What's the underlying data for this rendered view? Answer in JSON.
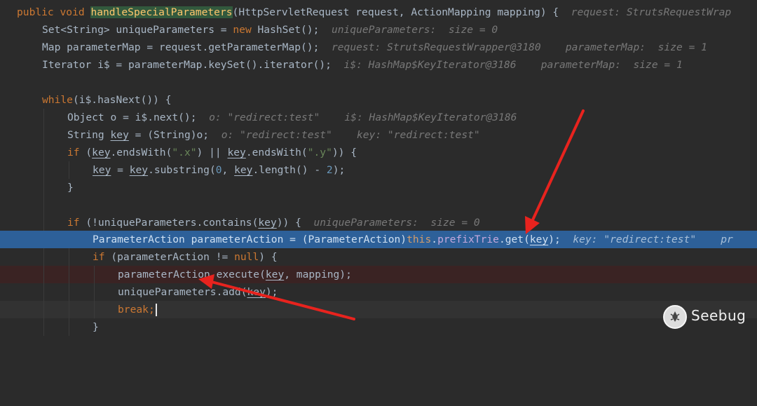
{
  "code": {
    "l1": {
      "kw": "public void ",
      "method": "handleSpecialParameters",
      "rest": "(HttpServletRequest request, ActionMapping mapping) {",
      "hint": "request: StrutsRequestWrap"
    },
    "l2": {
      "a": "Set<String> uniqueParameters = ",
      "kw": "new",
      "b": " HashSet();",
      "hint": "uniqueParameters:  size = 0"
    },
    "l3": {
      "a": "Map parameterMap = request.getParameterMap();",
      "hint": "request: StrutsRequestWrapper@3180    parameterMap:  size = 1"
    },
    "l4": {
      "a": "Iterator i$ = parameterMap.keySet().iterator();",
      "hint": "i$: HashMap$KeyIterator@3186    parameterMap:  size = 1"
    },
    "l6": {
      "kw": "while",
      "a": "(i$.hasNext()) {"
    },
    "l7": {
      "a": "Object o = i$.next();",
      "hint": "o: \"redirect:test\"    i$: HashMap$KeyIterator@3186"
    },
    "l8": {
      "a": "String ",
      "u": "key",
      "b": " = (String)o;",
      "hint": "o: \"redirect:test\"    key: \"redirect:test\""
    },
    "l9": {
      "kw": "if",
      "a": " (",
      "u1": "key",
      "b": ".endsWith(",
      "s1": "\".x\"",
      "c": ") || ",
      "u2": "key",
      "d": ".endsWith(",
      "s2": "\".y\"",
      "e": ")) {"
    },
    "l10": {
      "u1": "key",
      "a": " = ",
      "u2": "key",
      "b": ".substring(",
      "n1": "0",
      "c": ", ",
      "u3": "key",
      "d": ".length() - ",
      "n2": "2",
      "e": ");"
    },
    "l11": {
      "a": "}"
    },
    "l13": {
      "kw": "if",
      "a": " (!uniqueParameters.contains(",
      "u": "key",
      "b": ")) {",
      "hint": "uniqueParameters:  size = 0"
    },
    "l14": {
      "a": "ParameterAction parameterAction = (ParameterAction)",
      "kw": "this",
      "dot": ".",
      "fld": "prefixTrie",
      "b": ".get(",
      "u": "key",
      "c": ");",
      "hint": "key: \"redirect:test\"    pr"
    },
    "l15": {
      "kw": "if",
      "a": " (parameterAction != ",
      "kw2": "null",
      "b": ") {"
    },
    "l16": {
      "a": "parameterAction.execute(",
      "u": "key",
      "b": ", mapping);"
    },
    "l17": {
      "a": "uniqueParameters.add(",
      "u": "key",
      "b": ");"
    },
    "l18": {
      "kw": "break",
      "a": ";"
    },
    "l19": {
      "a": "}"
    }
  },
  "watermark": {
    "brand": "Seebug"
  },
  "annotation_color": "#e8231e"
}
